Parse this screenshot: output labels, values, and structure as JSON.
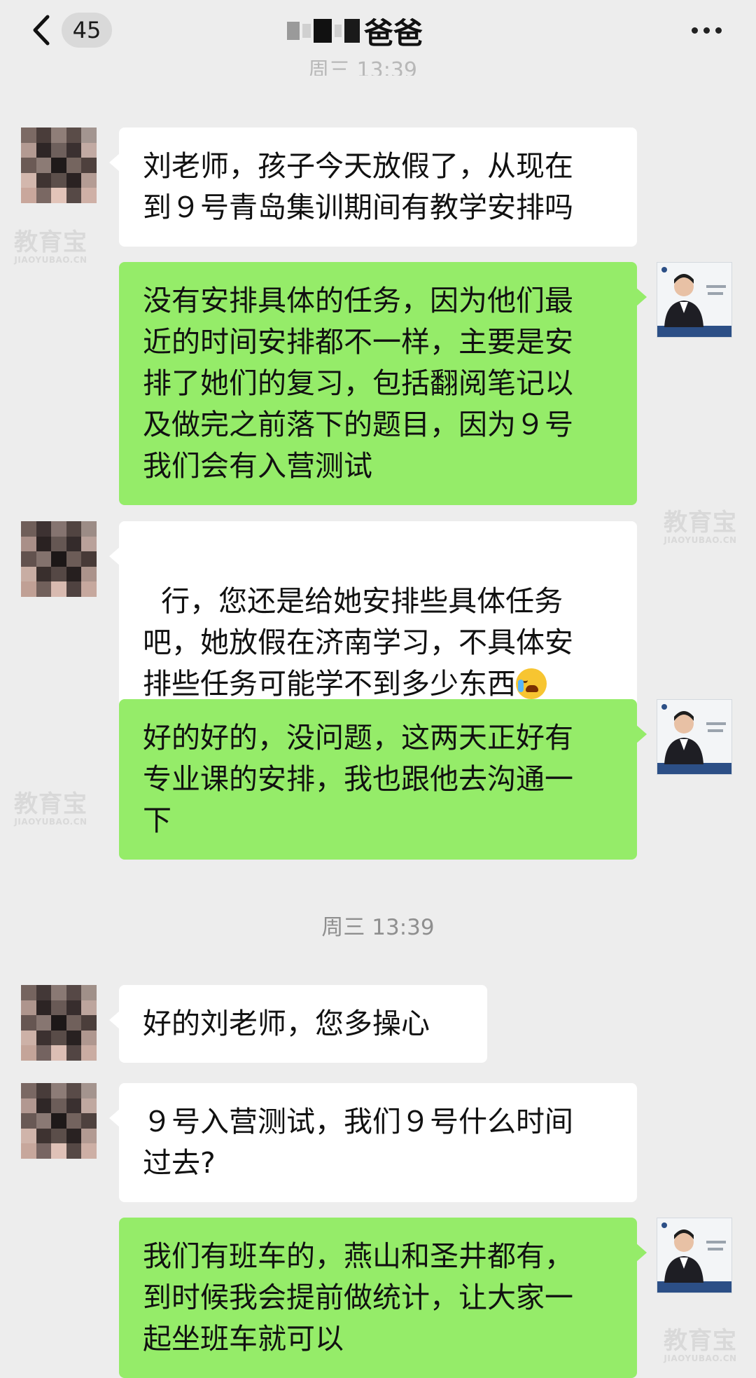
{
  "header": {
    "unread_count": "45",
    "title": "爸爸"
  },
  "ghost_timestamp": "周三 13:39",
  "messages": [
    {
      "side": "in",
      "text": "刘老师，孩子今天放假了，从现在\n到９号青岛集训期间有教学安排吗"
    },
    {
      "side": "out",
      "text": "没有安排具体的任务，因为他们最\n近的时间安排都不一样，主要是安\n排了她们的复习，包括翻阅笔记以\n及做完之前落下的题目，因为９号\n我们会有入营测试"
    },
    {
      "side": "in",
      "text": "行，您还是给她安排些具体任务\n吧，她放假在济南学习，不具体安\n排些任务可能学不到多少东西",
      "emoji": "crying-face-emoji"
    },
    {
      "side": "out",
      "text": "好的好的，没问题，这两天正好有\n专业课的安排，我也跟他去沟通一\n下"
    },
    {
      "side": "in",
      "text": "好的刘老师，您多操心"
    },
    {
      "side": "in",
      "text": "９号入营测试，我们９号什么时间\n过去?"
    },
    {
      "side": "out",
      "text": "我们有班车的，燕山和圣井都有，\n到时候我会提前做统计，让大家一\n起坐班车就可以"
    }
  ],
  "time_separator": "周三 13:39",
  "watermark": {
    "cn": "教育宝",
    "en": "JIAOYUBAO.CN"
  },
  "colors": {
    "background": "#ededed",
    "outgoing_bubble": "#95ec69",
    "incoming_bubble": "#ffffff"
  }
}
